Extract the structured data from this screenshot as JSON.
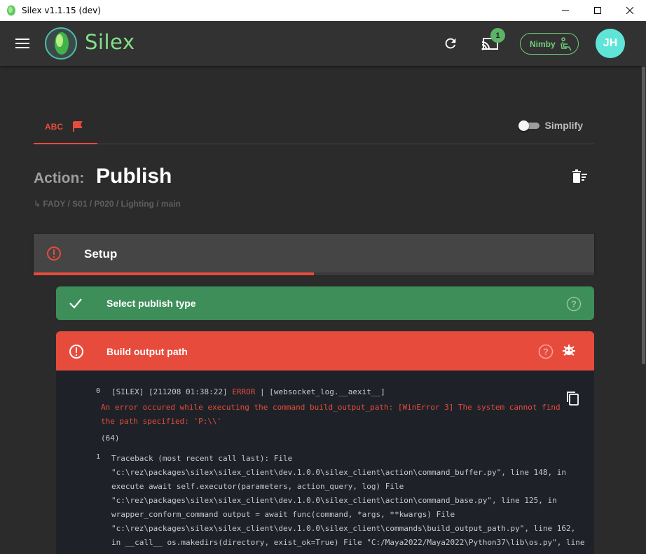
{
  "window": {
    "title": "Silex v1.1.15 (dev)",
    "controls": [
      "minimize",
      "maximize",
      "close"
    ]
  },
  "header": {
    "brand": "Silex",
    "notification_count": "1",
    "nimby_label": "Nimby",
    "avatar_initials": "JH",
    "accent_color": "#82e08a"
  },
  "tabs": [
    {
      "label": "ABC",
      "active": true,
      "flag_color": "#e74b3c"
    }
  ],
  "simplify": {
    "label": "Simplify",
    "enabled": false
  },
  "action": {
    "prefix": "Action:",
    "name": "Publish",
    "breadcrumb": "↳ FADY / S01 / P020 / Lighting / main"
  },
  "setup": {
    "label": "Setup",
    "status": "error",
    "progress_fraction": 0.5
  },
  "steps": [
    {
      "label": "Select publish type",
      "status": "success",
      "color": "#3e8e5a"
    },
    {
      "label": "Build output path",
      "status": "error",
      "color": "#e74b3c"
    }
  ],
  "logs": [
    {
      "index": "0",
      "prefix": "[SILEX] [211208 01:38:22]",
      "level": "ERROR",
      "source": "| [websocket_log.__aexit__]",
      "message_lines": [
        "An error occured while executing the command build_output_path: [WinError 3] The system cannot find",
        "the path specified: 'P:\\\\'"
      ],
      "code": "(64)"
    },
    {
      "index": "1",
      "lines": [
        "Traceback (most recent call last): File",
        "\"c:\\rez\\packages\\silex\\silex_client\\dev.1.0.0\\silex_client\\action\\command_buffer.py\", line 148, in",
        "execute await self.executor(parameters, action_query, log) File",
        "\"c:\\rez\\packages\\silex\\silex_client\\dev.1.0.0\\silex_client\\action\\command_base.py\", line 125, in",
        "wrapper_conform_command output = await func(command, *args, **kwargs) File",
        "\"c:\\rez\\packages\\silex\\silex_client\\dev.1.0.0\\silex_client\\commands\\build_output_path.py\", line 162,",
        "in __call__ os.makedirs(directory, exist_ok=True) File \"C:/Maya2022/Maya2022\\Python37\\lib\\os.py\", line"
      ]
    }
  ]
}
